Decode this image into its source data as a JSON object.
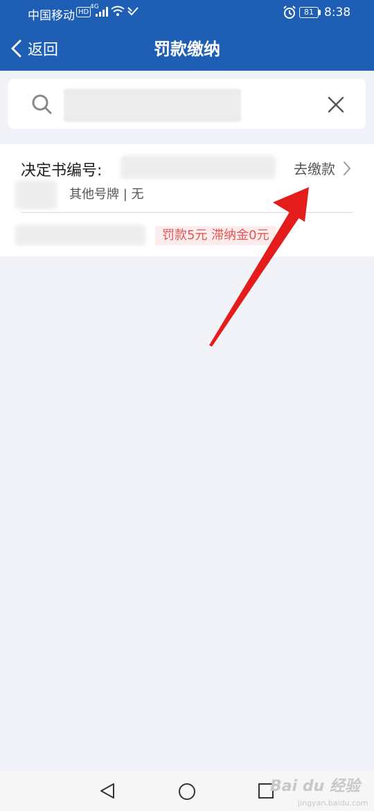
{
  "status_bar": {
    "carrier": "中国移动",
    "hd": "HD",
    "network": "4G",
    "battery": "81",
    "time": "8:38",
    "icons": [
      "signal-icon",
      "wifi-icon",
      "data-saver-icon",
      "alarm-icon",
      "battery-icon"
    ]
  },
  "header": {
    "back_label": "返回",
    "title": "罚款缴纳",
    "background": "#1e5fb5"
  },
  "search": {
    "value": "",
    "icons": [
      "search-icon",
      "close-icon"
    ]
  },
  "record": {
    "decision_label": "决定书编号:",
    "pay_label": "去缴款",
    "plate_info": "其他号牌 | 无",
    "fine_text": "罚款5元 滞纳金0元",
    "accent_color": "#e05555"
  },
  "watermark": {
    "text": "Bai du 经验",
    "sub": "jingyan.baidu.com"
  }
}
